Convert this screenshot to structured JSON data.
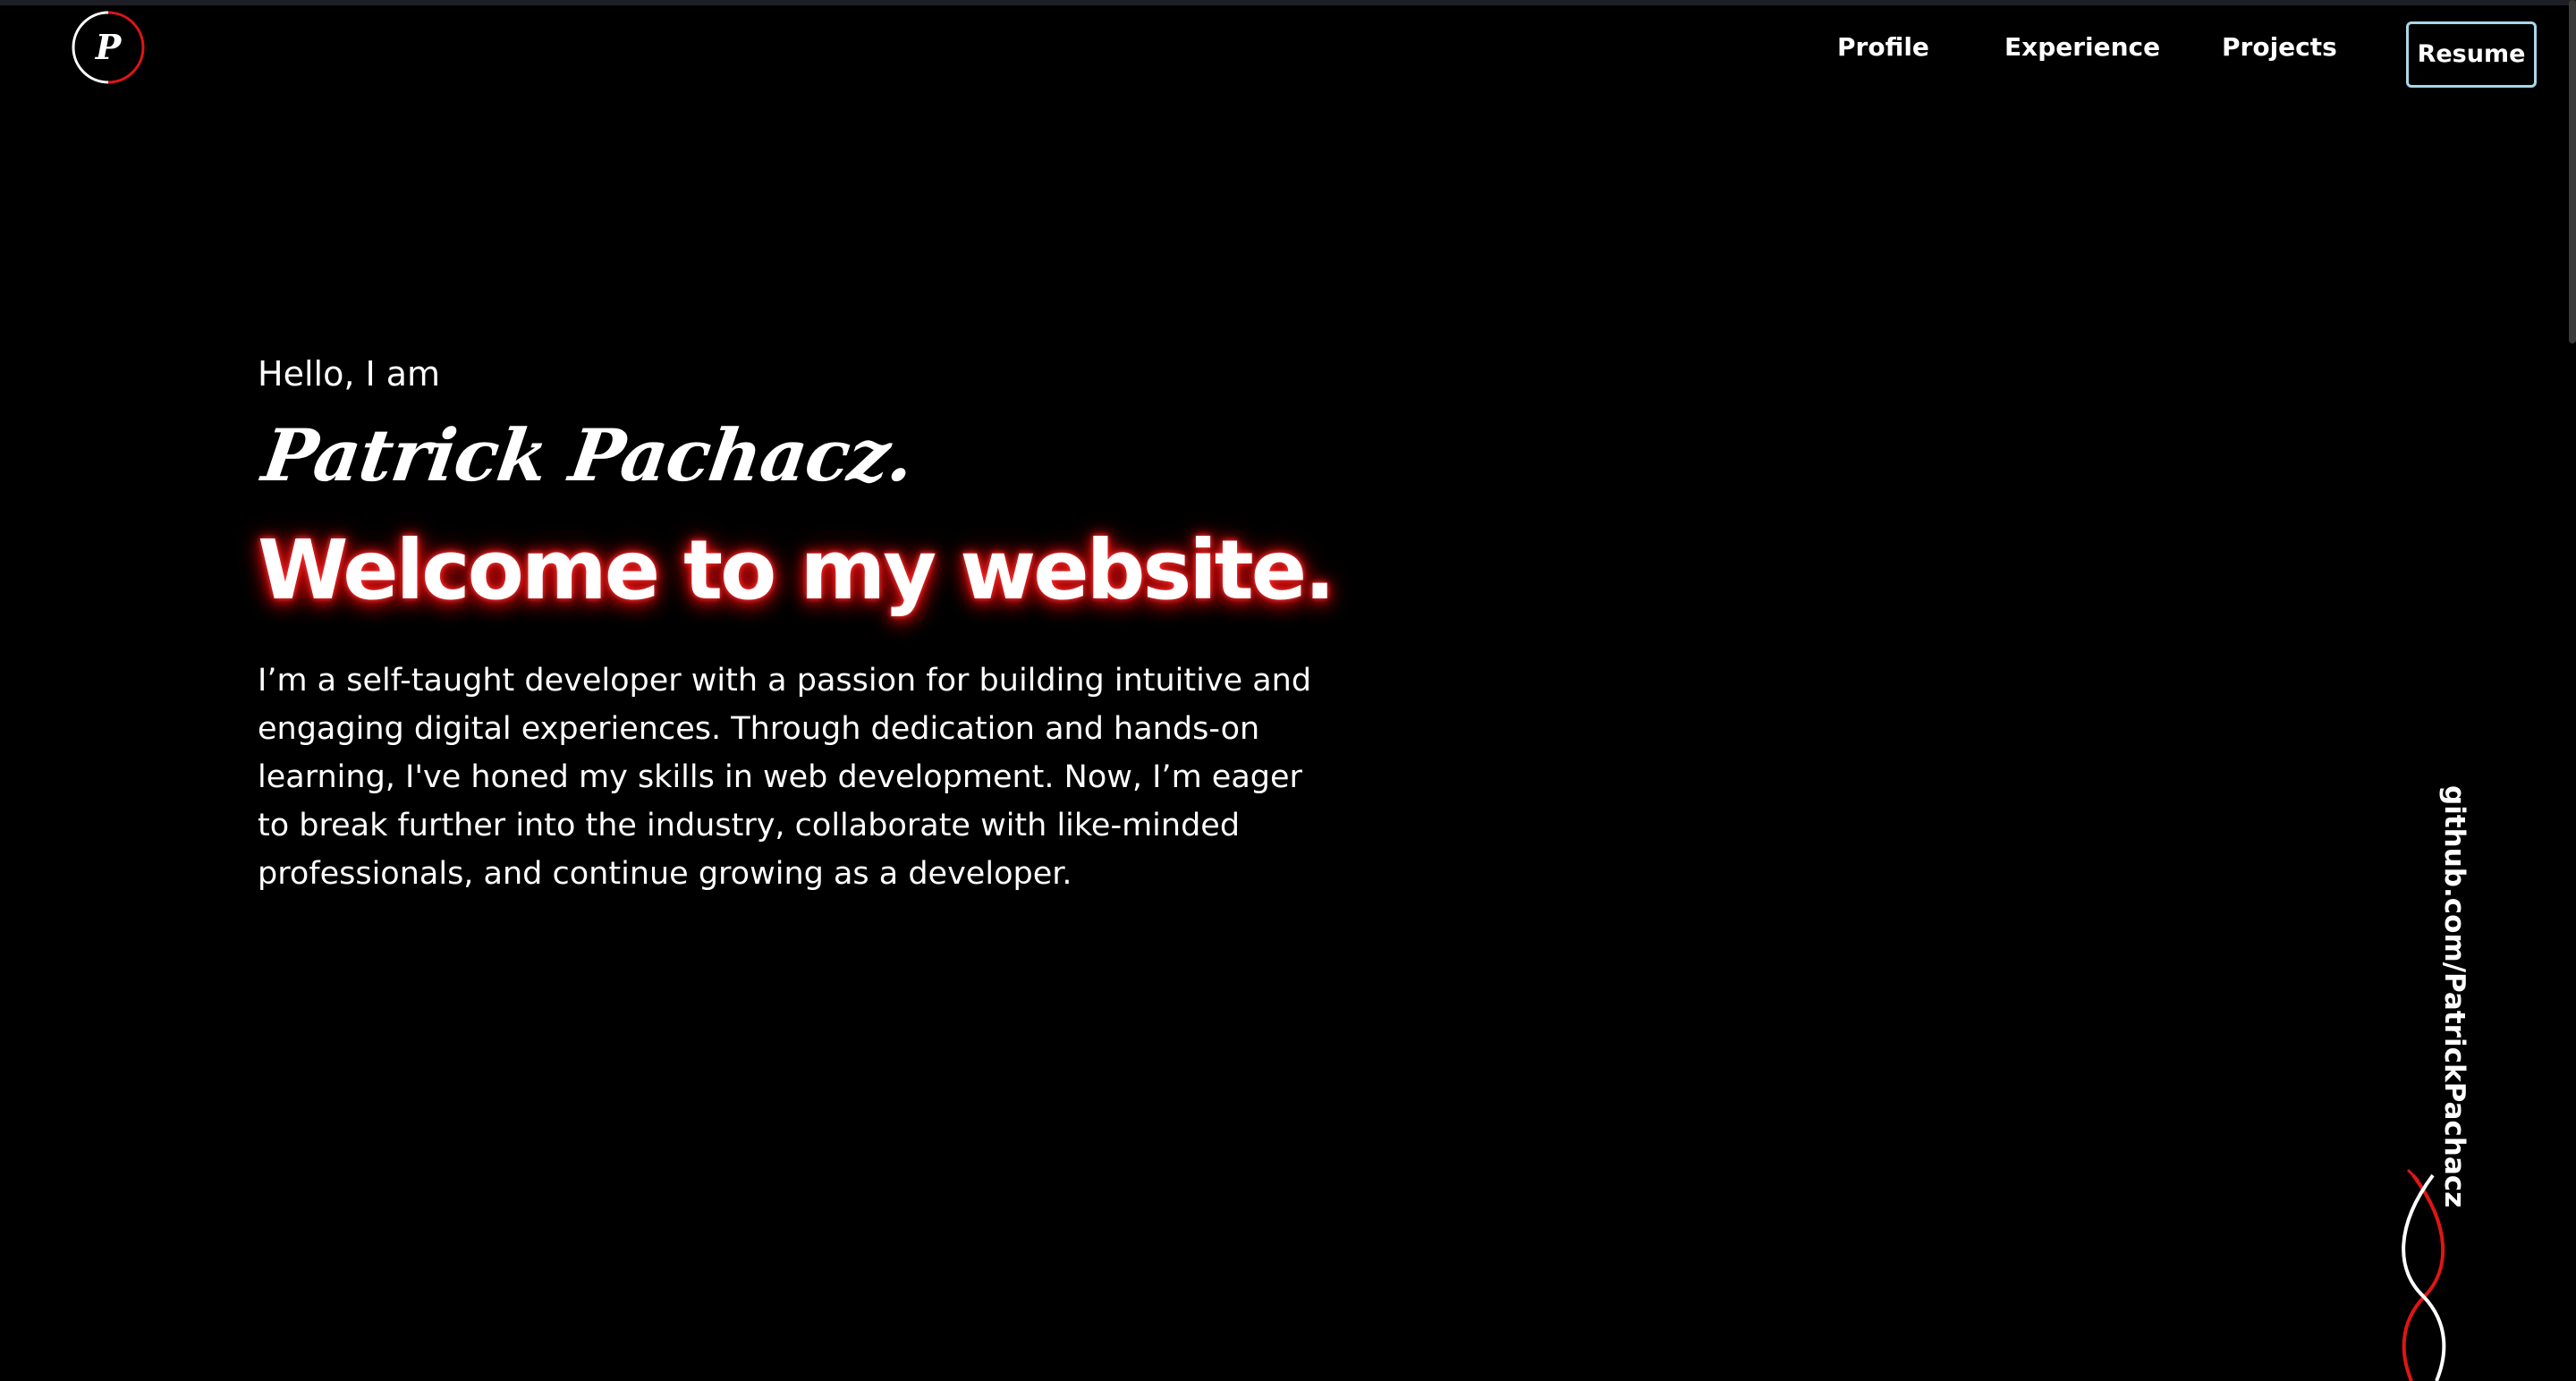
{
  "logo": {
    "letter": "P",
    "icon": "logo-p-circle-icon"
  },
  "nav": {
    "items": [
      {
        "label": "Profile"
      },
      {
        "label": "Experience"
      },
      {
        "label": "Projects"
      }
    ],
    "resume_label": "Resume"
  },
  "hero": {
    "greeting": "Hello, I am",
    "name": "Patrick Pachacz.",
    "headline": "Welcome to my website.",
    "intro": "I’m a self-taught developer with a passion for building intuitive and engaging digital experiences. Through dedication and hands-on learning, I've honed my skills in web development. Now, I’m eager to break further into the industry, collaborate with like-minded professionals, and continue growing as a developer."
  },
  "side_link": {
    "label": "github.com/PatrickPachacz",
    "icon": "helix-icon"
  },
  "colors": {
    "background": "#000000",
    "text": "#ffffff",
    "accent_red": "#e01515",
    "resume_border": "#a8d8e8"
  }
}
